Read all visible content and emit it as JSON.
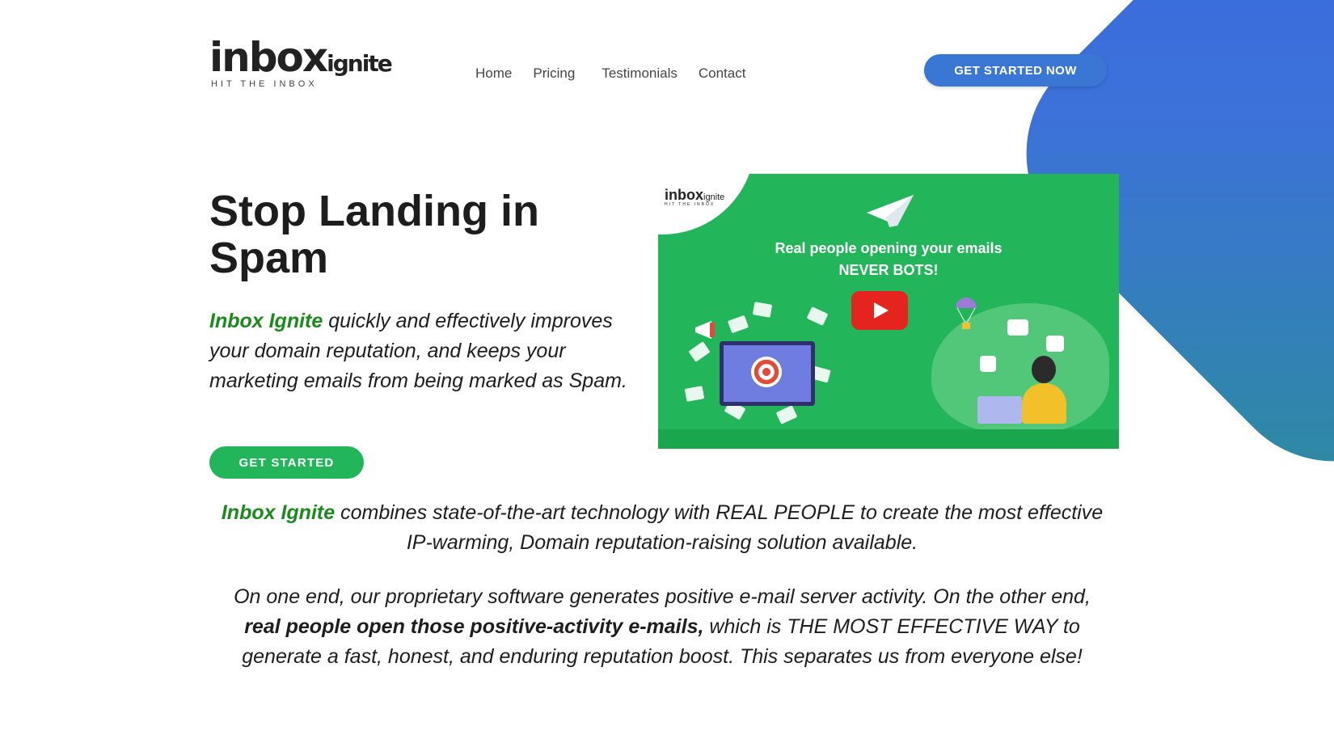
{
  "brand": {
    "logo_main": "inbox",
    "logo_sub": "ignite",
    "logo_tagline": "HIT THE INBOX"
  },
  "nav": {
    "items": [
      "Home",
      "Pricing",
      "Testimonials",
      "Contact"
    ]
  },
  "header": {
    "cta_label": "GET STARTED NOW"
  },
  "hero": {
    "title": "Stop Landing in Spam",
    "intro_brand": "Inbox Ignite",
    "intro_text": " quickly and effectively improves your domain reputation, and keeps your marketing emails from being marked as Spam.",
    "cta_label": "GET STARTED"
  },
  "video": {
    "logo_main": "inbox",
    "logo_sub": "ignite",
    "logo_tagline": "HIT THE INBOX",
    "headline_line1": "Real people opening your emails",
    "headline_line2": "NEVER BOTS!",
    "play_icon": "play-icon"
  },
  "content": {
    "para1_brand": "Inbox Ignite",
    "para1_text": " combines state-of-the-art technology with REAL PEOPLE to create the most effective IP-warming, Domain reputation-raising solution available.",
    "para2_start": "On one end, our proprietary software generates positive e-mail server activity. On the other end, ",
    "para2_bold": "real people open those positive-activity e-mails,",
    "para2_end": " which is THE MOST EFFECTIVE WAY to generate a fast, honest, and enduring reputation boost. This separates us from everyone else!"
  },
  "colors": {
    "brand_green": "#22b55a",
    "brand_blue": "#3a76d4",
    "play_red": "#e52420"
  }
}
